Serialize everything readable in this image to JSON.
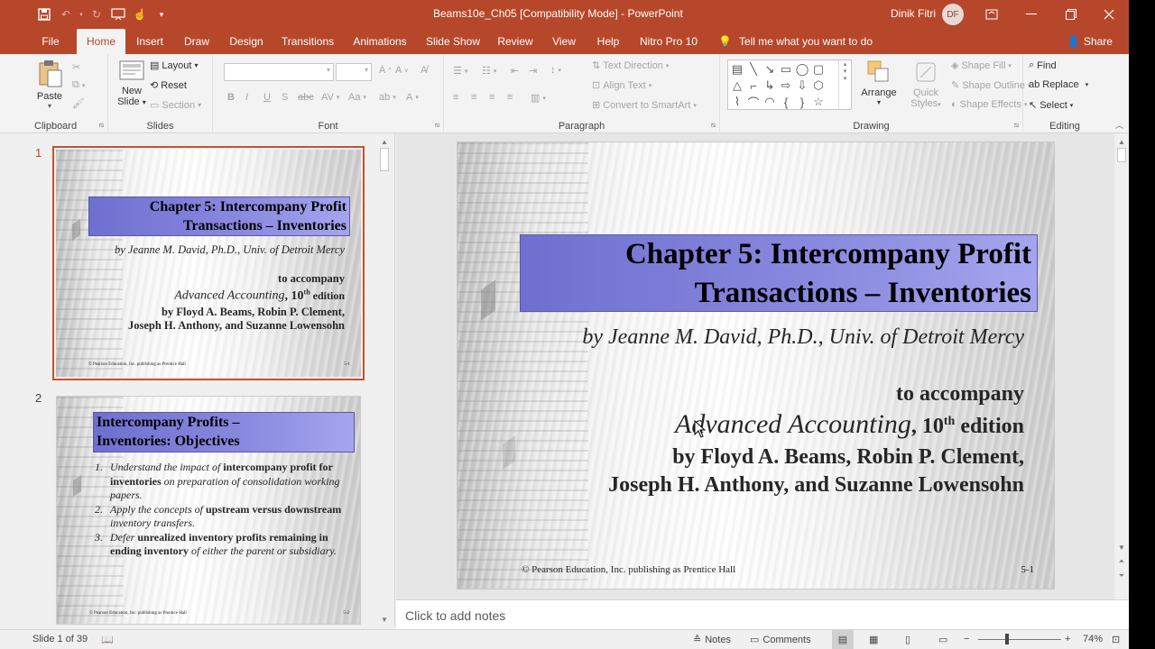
{
  "app": {
    "window_title": "Beams10e_Ch05 [Compatibility Mode]  -  PowerPoint",
    "user_name": "Dinik Fitri",
    "user_initials": "DF"
  },
  "tabs": [
    "File",
    "Home",
    "Insert",
    "Draw",
    "Design",
    "Transitions",
    "Animations",
    "Slide Show",
    "Review",
    "View",
    "Help",
    "Nitro Pro 10"
  ],
  "active_tab": "Home",
  "tell_me": "Tell me what you want to do",
  "share": "Share",
  "ribbon": {
    "clipboard": {
      "label": "Clipboard",
      "paste": "Paste"
    },
    "slides": {
      "label": "Slides",
      "new_slide_1": "New",
      "new_slide_2": "Slide",
      "layout": "Layout",
      "reset": "Reset",
      "section": "Section"
    },
    "font": {
      "label": "Font"
    },
    "paragraph": {
      "label": "Paragraph",
      "text_direction": "Text Direction",
      "align_text": "Align Text",
      "convert": "Convert to SmartArt"
    },
    "drawing": {
      "label": "Drawing",
      "arrange": "Arrange",
      "quick_styles_1": "Quick",
      "quick_styles_2": "Styles",
      "shape_fill": "Shape Fill",
      "shape_outline": "Shape Outline",
      "shape_effects": "Shape Effects"
    },
    "editing": {
      "label": "Editing",
      "find": "Find",
      "replace": "Replace",
      "select": "Select"
    }
  },
  "thumbnails": [
    {
      "number": "1",
      "title_line1": "Chapter 5: Intercompany Profit",
      "title_line2": "Transactions – Inventories",
      "byline": "by Jeanne M. David, Ph.D., Univ. of Detroit Mercy",
      "accompany": "to accompany",
      "book": "Advanced Accounting",
      "edition_num": "10",
      "edition_sup": "th",
      "edition_word": " edition",
      "authors1": "by Floyd A. Beams, Robin P. Clement,",
      "authors2": "Joseph H. Anthony, and Suzanne Lowensohn",
      "copyright": "© Pearson Education, Inc. publishing as Prentice Hall",
      "page": "5-1"
    },
    {
      "number": "2",
      "title_line1": "Intercompany Profits –",
      "title_line2": "Inventories: Objectives",
      "items": [
        {
          "n": "1.",
          "a": "Understand the impact of ",
          "b": "intercompany profit for inventories",
          "c": " on preparation of consolidation working papers."
        },
        {
          "n": "2.",
          "a": "Apply the concepts of ",
          "b": "upstream versus downstream",
          "c": " inventory transfers."
        },
        {
          "n": "3.",
          "a": "Defer ",
          "b": "unrealized inventory profits remaining in ending inventory",
          "c": " of either the parent or subsidiary."
        }
      ],
      "copyright": "© Pearson Education, Inc. publishing as Prentice Hall",
      "page": "5-2"
    }
  ],
  "slide": {
    "title_line1": "Chapter 5: Intercompany Profit",
    "title_line2": "Transactions – Inventories",
    "byline": "by Jeanne M. David, Ph.D., Univ. of Detroit Mercy",
    "accompany": "to accompany",
    "book": "Advanced Accounting",
    "edition_num": "10",
    "edition_sup": "th",
    "edition_word": " edition",
    "authors1": "by Floyd A. Beams, Robin P. Clement,",
    "authors2": "Joseph H. Anthony, and Suzanne Lowensohn",
    "copyright": "© Pearson Education, Inc. publishing as Prentice Hall",
    "page": "5-1"
  },
  "notes_placeholder": "Click to add notes",
  "status": {
    "slide_info": "Slide 1 of 39",
    "notes": "Notes",
    "comments": "Comments",
    "zoom": "74%"
  },
  "colors": {
    "accent": "#b7472a",
    "title_box": "#8a8ae0"
  }
}
